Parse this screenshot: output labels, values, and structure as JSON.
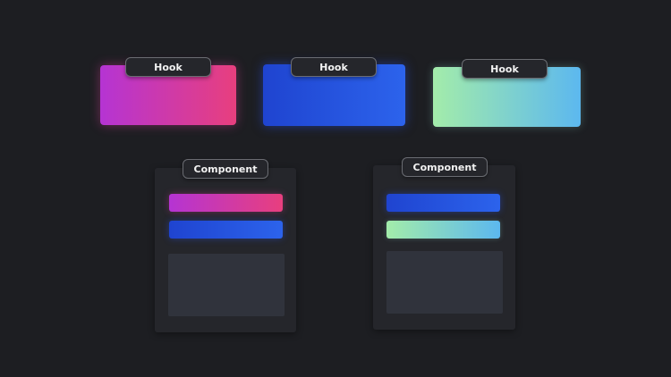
{
  "hooks": [
    {
      "label": "Hook"
    },
    {
      "label": "Hook"
    },
    {
      "label": "Hook"
    }
  ],
  "components": [
    {
      "label": "Component"
    },
    {
      "label": "Component"
    }
  ],
  "colors": {
    "background": "#1d1e22",
    "panel": "#25262b",
    "content_box": "#30333c",
    "pink_gradient": [
      "#b534d3",
      "#e83f7e"
    ],
    "blue_gradient": [
      "#1f44d0",
      "#2c63ec"
    ],
    "green_gradient": [
      "#a3ecaa",
      "#5cb8ef"
    ]
  }
}
